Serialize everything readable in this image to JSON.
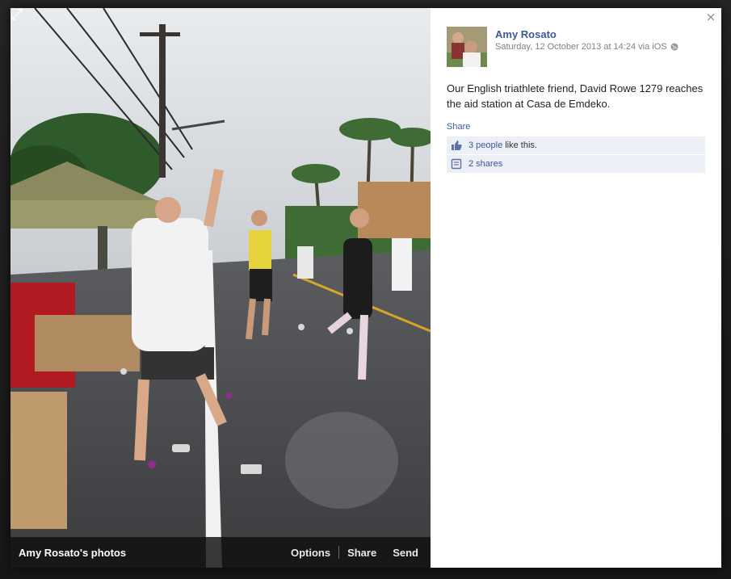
{
  "photo": {
    "album_label": "Amy Rosato's photos",
    "actions": [
      "Options",
      "Share",
      "Send"
    ],
    "icons": {
      "expand": "expand-icon"
    }
  },
  "post": {
    "author": "Amy Rosato",
    "timestamp": "Saturday, 12 October 2013 at 14:24 via iOS",
    "privacy_icon": "globe-icon",
    "caption": "Our English triathlete friend, David Rowe 1279 reaches the aid station at Casa de Emdeko.",
    "share_label": "Share",
    "likes": {
      "link": "3 people",
      "rest": "like this."
    },
    "shares": {
      "link": "2 shares"
    }
  },
  "window": {
    "close_icon": "close-icon",
    "close_glyph": "×"
  },
  "colors": {
    "link": "#3b5998",
    "ufi_bg": "#eceff5",
    "photo_bar": "#0f0f0f"
  }
}
